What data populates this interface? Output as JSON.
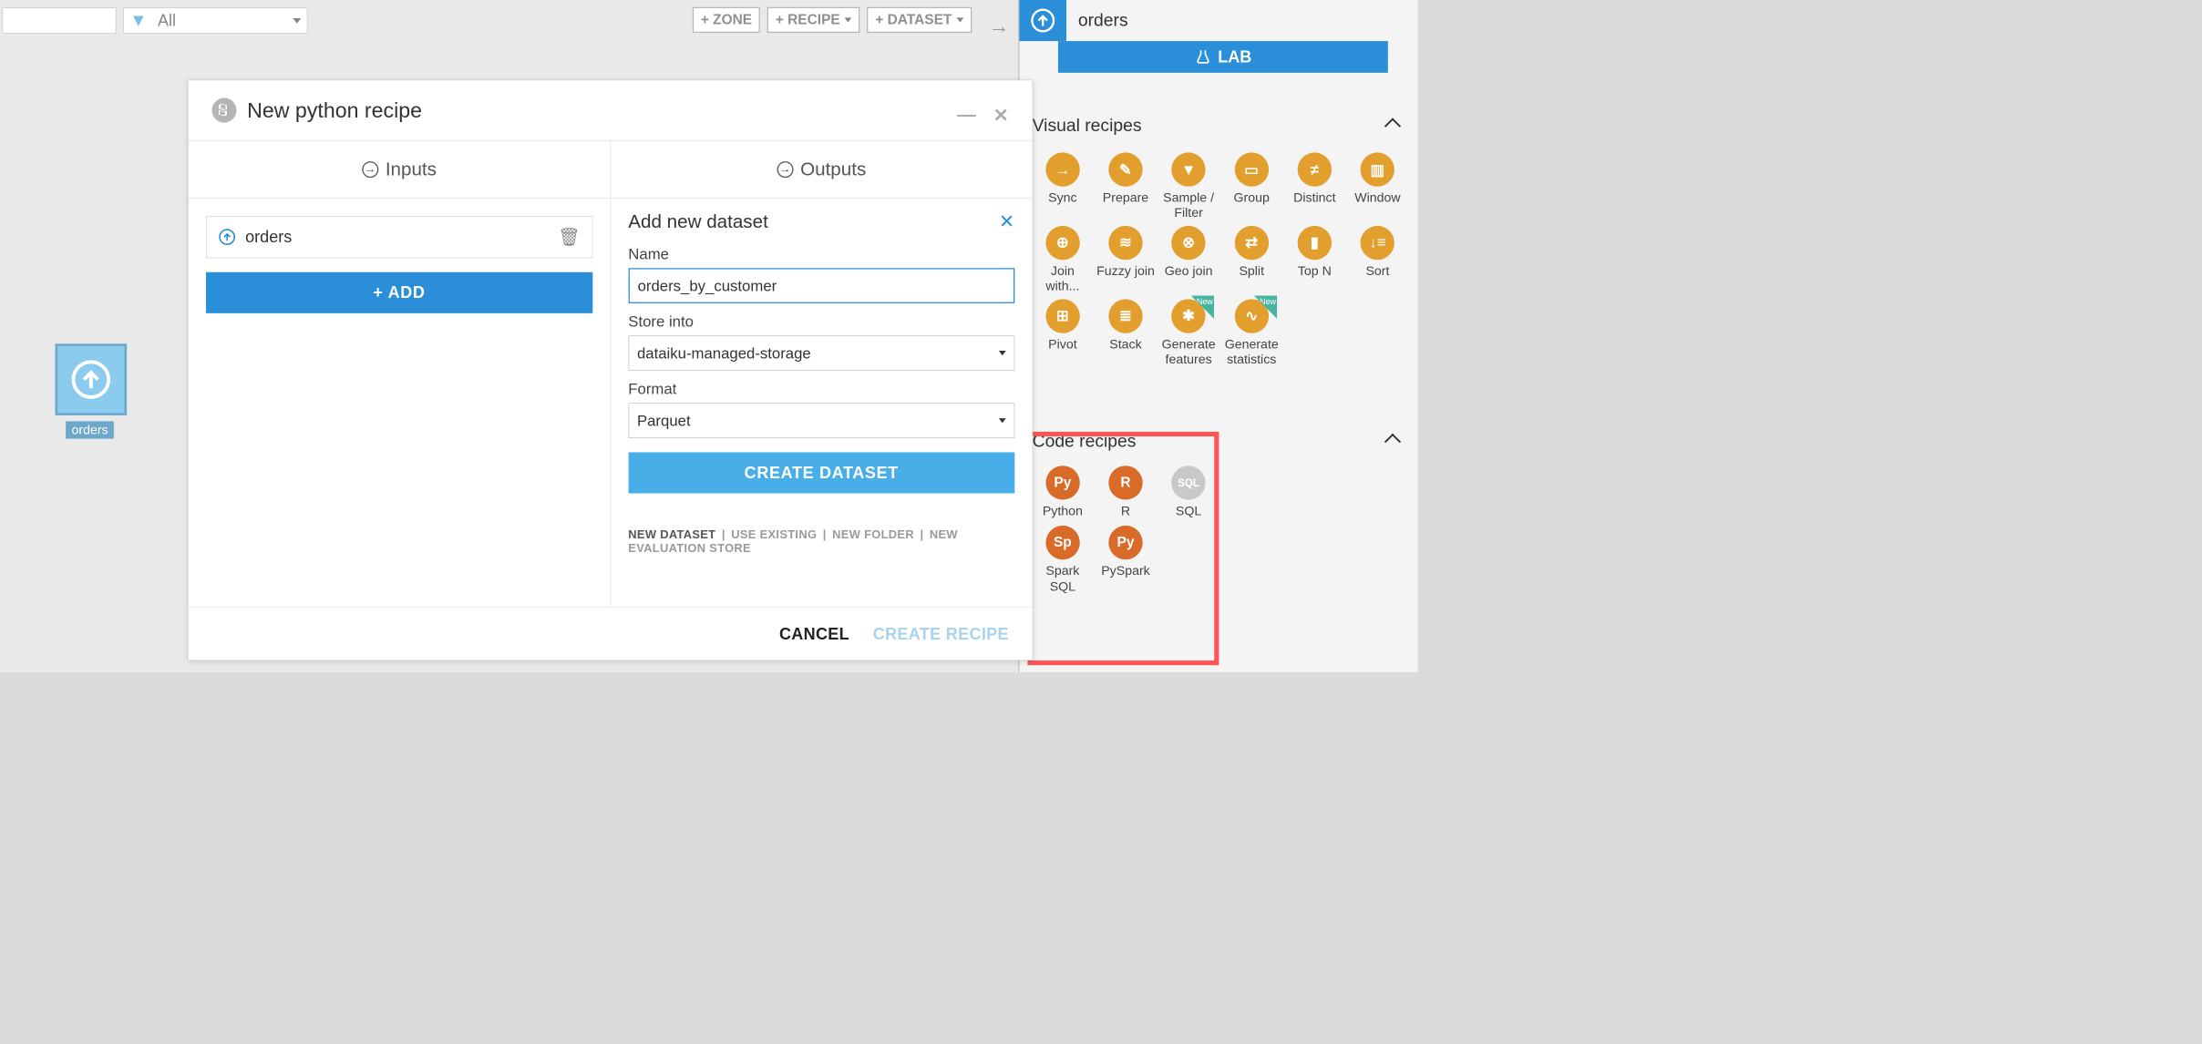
{
  "toolbar": {
    "filter_label": "All",
    "zone_btn": "+ ZONE",
    "recipe_btn": "+ RECIPE",
    "dataset_btn": "+ DATASET"
  },
  "canvas": {
    "node_label": "orders"
  },
  "side": {
    "dataset_name": "orders",
    "lab_label": "LAB",
    "visual_title": "Visual recipes",
    "code_title": "Code recipes",
    "visual_recipes": [
      {
        "label": "Sync",
        "ico": "→"
      },
      {
        "label": "Prepare",
        "ico": "✎"
      },
      {
        "label": "Sample / Filter",
        "ico": "▼"
      },
      {
        "label": "Group",
        "ico": "▭"
      },
      {
        "label": "Distinct",
        "ico": "≠"
      },
      {
        "label": "Window",
        "ico": "▥"
      },
      {
        "label": "Join with...",
        "ico": "⊕"
      },
      {
        "label": "Fuzzy join",
        "ico": "≋"
      },
      {
        "label": "Geo join",
        "ico": "⊗"
      },
      {
        "label": "Split",
        "ico": "⇄"
      },
      {
        "label": "Top N",
        "ico": "▮"
      },
      {
        "label": "Sort",
        "ico": "↓≡"
      },
      {
        "label": "Pivot",
        "ico": "⊞"
      },
      {
        "label": "Stack",
        "ico": "≣"
      },
      {
        "label": "Generate features",
        "ico": "✱",
        "new": true
      },
      {
        "label": "Generate statistics",
        "ico": "∿",
        "new": true
      }
    ],
    "code_recipes": [
      {
        "label": "Python",
        "ico": "Py",
        "cls": "orange2"
      },
      {
        "label": "R",
        "ico": "R",
        "cls": "orange2"
      },
      {
        "label": "SQL",
        "ico": "SQL",
        "cls": "disabled"
      },
      {
        "label": "",
        "ico": ""
      },
      {
        "label": "",
        "ico": ""
      },
      {
        "label": "",
        "ico": ""
      },
      {
        "label": "Spark SQL",
        "ico": "Sp",
        "cls": "orange2"
      },
      {
        "label": "PySpark",
        "ico": "Py",
        "cls": "orange2"
      }
    ]
  },
  "modal": {
    "title": "New python recipe",
    "inputs_label": "Inputs",
    "outputs_label": "Outputs",
    "input_item": "orders",
    "add_btn": "+ ADD",
    "out_title": "Add new dataset",
    "name_label": "Name",
    "name_value": "orders_by_customer",
    "store_label": "Store into",
    "store_value": "dataiku-managed-storage",
    "format_label": "Format",
    "format_value": "Parquet",
    "create_ds_btn": "CREATE DATASET",
    "links": {
      "new_dataset": "NEW DATASET",
      "use_existing": "USE EXISTING",
      "new_folder": "NEW FOLDER",
      "new_eval": "NEW EVALUATION STORE"
    },
    "cancel_btn": "CANCEL",
    "create_recipe_btn": "CREATE RECIPE"
  }
}
